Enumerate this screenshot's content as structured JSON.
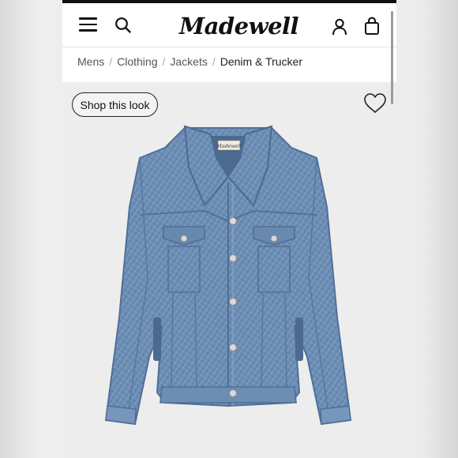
{
  "header": {
    "brand": "Madewell",
    "icons": [
      "menu-icon",
      "search-icon",
      "account-icon",
      "shopping-bag-icon"
    ]
  },
  "breadcrumb": {
    "items": [
      "Mens",
      "Clothing",
      "Jackets",
      "Denim & Trucker"
    ],
    "separator": "/"
  },
  "product": {
    "shop_look_label": "Shop this look",
    "favorite_icon": "heart-icon",
    "jacket_label_text": "Madewell",
    "colors": {
      "denim": "#6d8eb4",
      "denim_dark": "#4f6f97",
      "denim_light": "#a8bfd8",
      "background": "#ededed"
    }
  }
}
